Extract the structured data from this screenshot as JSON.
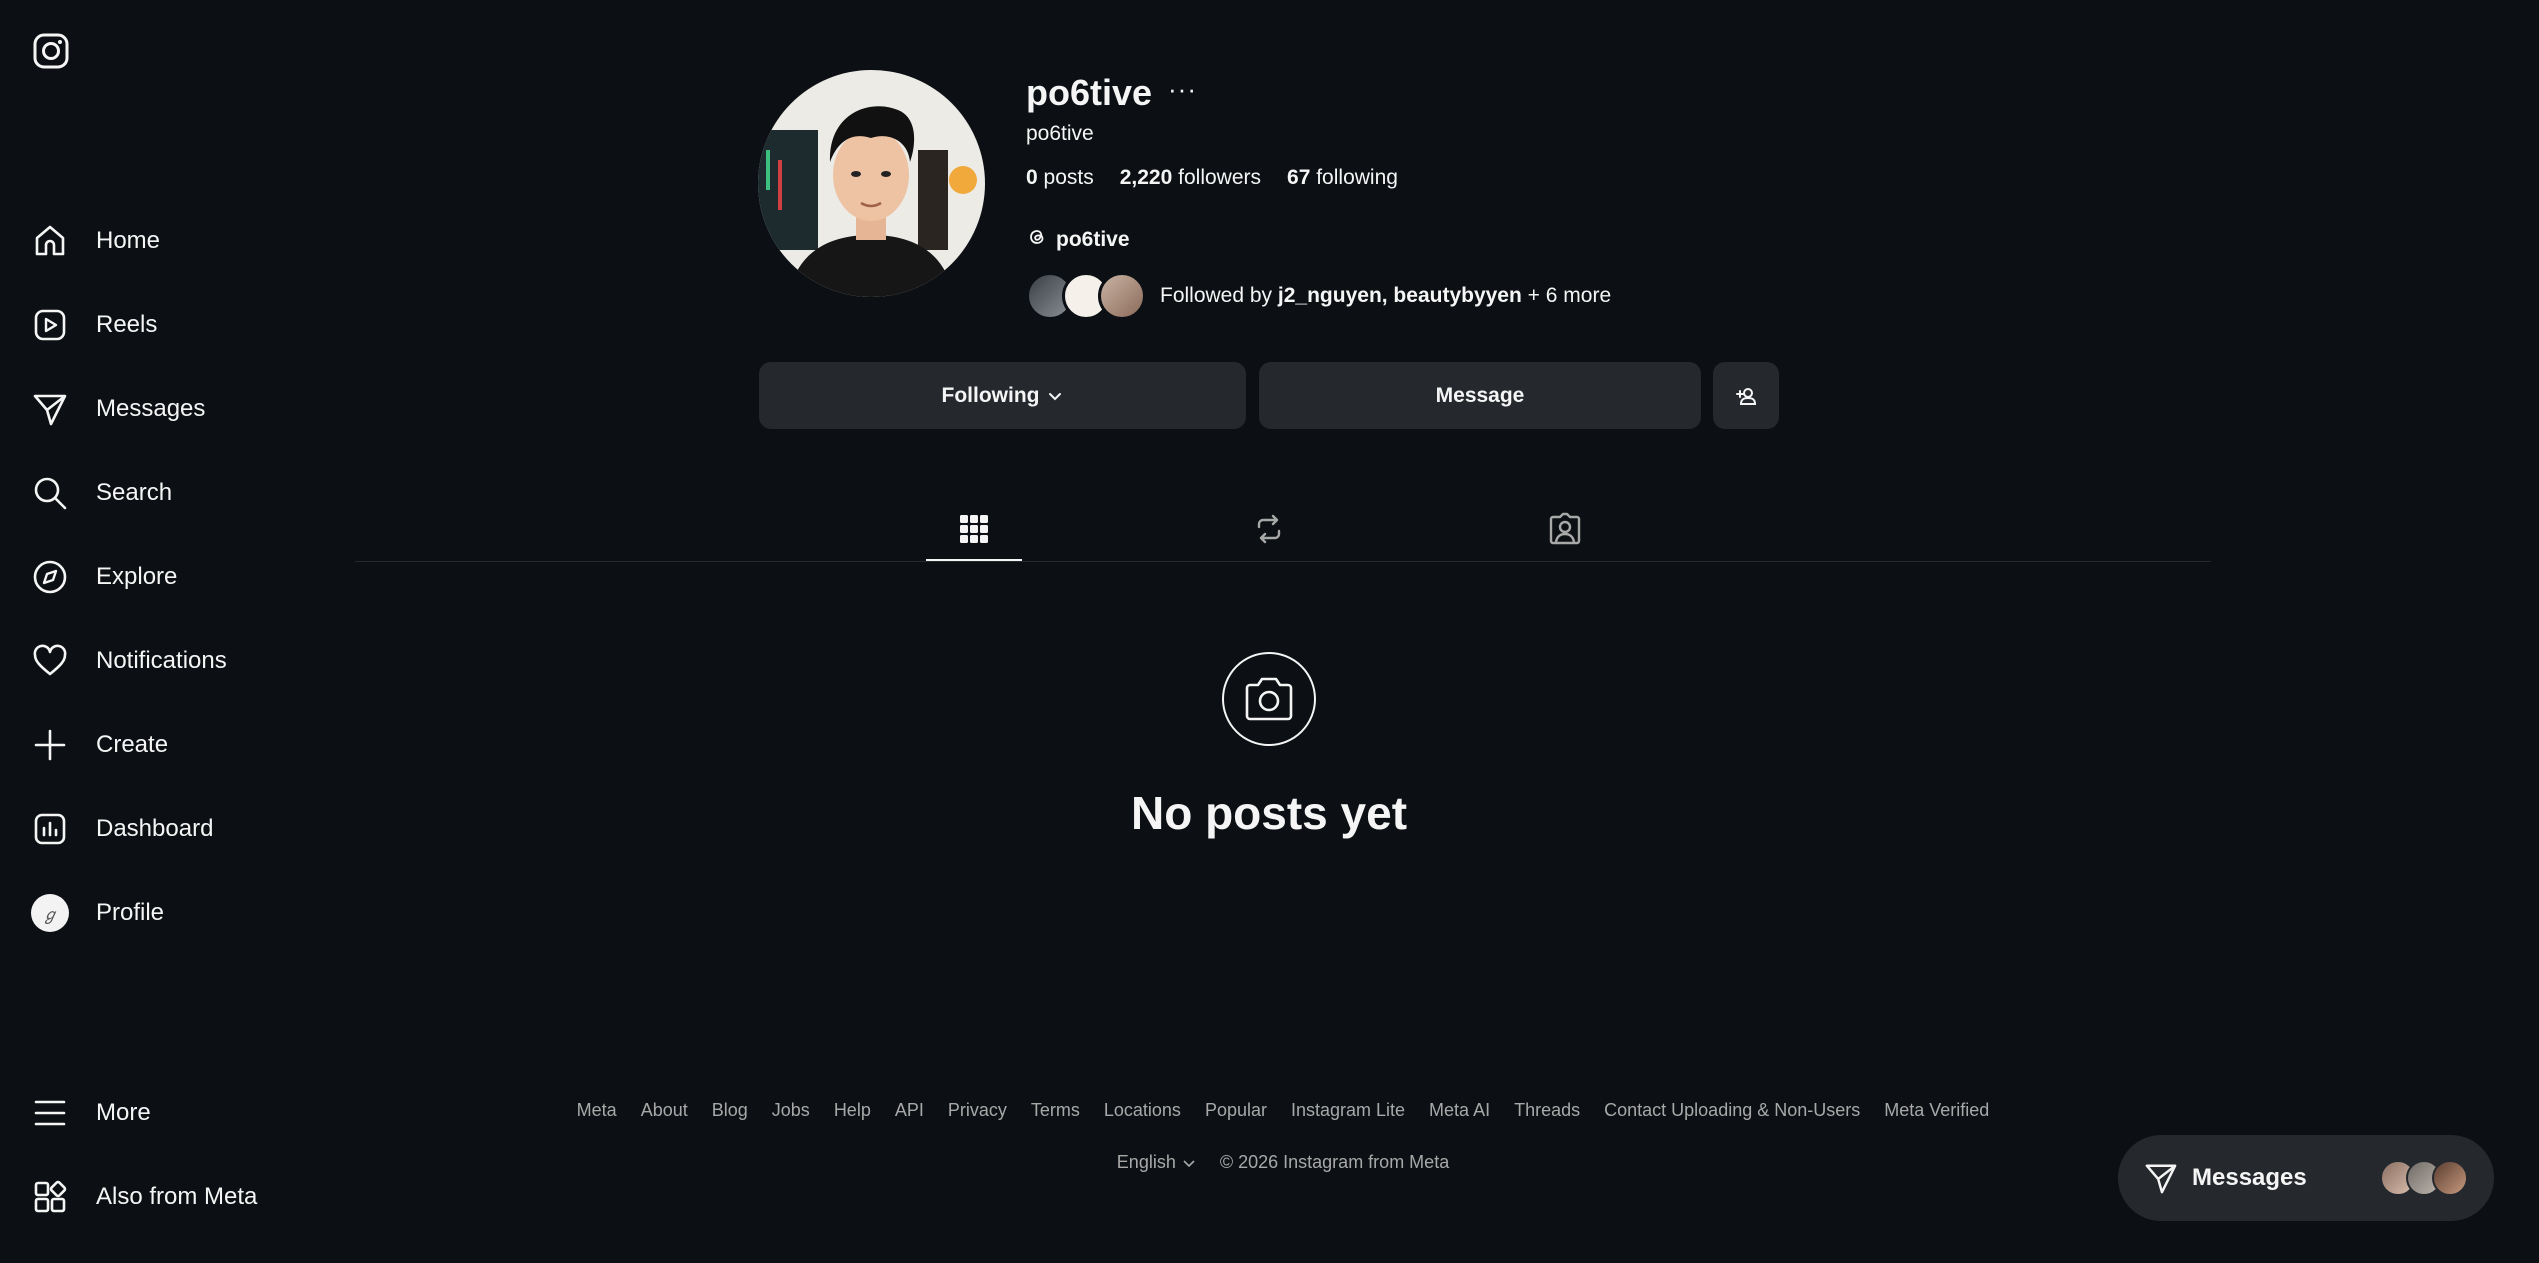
{
  "sidebar": {
    "logo": "instagram-logo",
    "items": [
      {
        "label": "Home",
        "icon": "home-icon"
      },
      {
        "label": "Reels",
        "icon": "reels-icon"
      },
      {
        "label": "Messages",
        "icon": "messages-icon"
      },
      {
        "label": "Search",
        "icon": "search-icon"
      },
      {
        "label": "Explore",
        "icon": "explore-icon"
      },
      {
        "label": "Notifications",
        "icon": "heart-icon"
      },
      {
        "label": "Create",
        "icon": "plus-icon"
      },
      {
        "label": "Dashboard",
        "icon": "dashboard-icon"
      },
      {
        "label": "Profile",
        "icon": "avatar"
      }
    ],
    "more": "More",
    "also_from_meta": "Also from Meta"
  },
  "profile": {
    "username": "po6tive",
    "handle": "po6tive",
    "posts_count": "0",
    "posts_label": "posts",
    "followers_count": "2,220",
    "followers_label": "followers",
    "following_count": "67",
    "following_label": "following",
    "threads_handle": "po6tive",
    "followed_by_prefix": "Followed by",
    "followed_by_names": "j2_nguyen, beautybyyen",
    "followed_by_more": "+ 6 more"
  },
  "actions": {
    "following": "Following",
    "message": "Message"
  },
  "tabs": [
    "posts-grid-icon",
    "reposts-icon",
    "tagged-icon"
  ],
  "empty_state": {
    "title": "No posts yet"
  },
  "footer": {
    "links": [
      "Meta",
      "About",
      "Blog",
      "Jobs",
      "Help",
      "API",
      "Privacy",
      "Terms",
      "Locations",
      "Popular",
      "Instagram Lite",
      "Meta AI",
      "Threads",
      "Contact Uploading & Non-Users",
      "Meta Verified"
    ],
    "language": "English",
    "copyright": "© 2026 Instagram from Meta"
  },
  "messages_pill": {
    "label": "Messages"
  },
  "colors": {
    "background": "#0c1014",
    "button": "#25292e",
    "text": "#f5f5f5",
    "muted": "#a8a8a8"
  }
}
